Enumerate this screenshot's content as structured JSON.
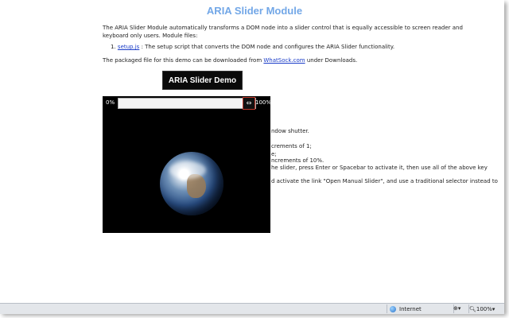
{
  "header": {
    "title": "ARIA Slider Module"
  },
  "intro": {
    "text": "The ARIA Slider Module automatically transforms a DOM node into a slider control that is equally accessible to screen reader and keyboard only users. Module files:"
  },
  "files": [
    {
      "num": "1.",
      "link": "setup.js",
      "desc": ": The setup script that converts the DOM node and configures the ARIA Slider functionality."
    }
  ],
  "download": {
    "before": "The packaged file for this demo can be downloaded from ",
    "link": "WhatSock.com",
    "after": " under Downloads."
  },
  "demo_button": "ARIA Slider Demo",
  "slider": {
    "min_label": "0%",
    "max_label": "100%",
    "handle_icon": "resize-arrows-icon",
    "handle_glyph": "⇔"
  },
  "tail_lines": [
    "ndow shutter.",
    "",
    "crements of 1;",
    "e;",
    "ncrements of 10%.",
    "he slider, press Enter or Spacebar to activate it, then use all of the above key",
    "",
    "d activate the link \"Open Manual Slider\", and use a traditional selector instead to"
  ],
  "statusbar": {
    "zone": "Internet",
    "zoom": "100%"
  }
}
